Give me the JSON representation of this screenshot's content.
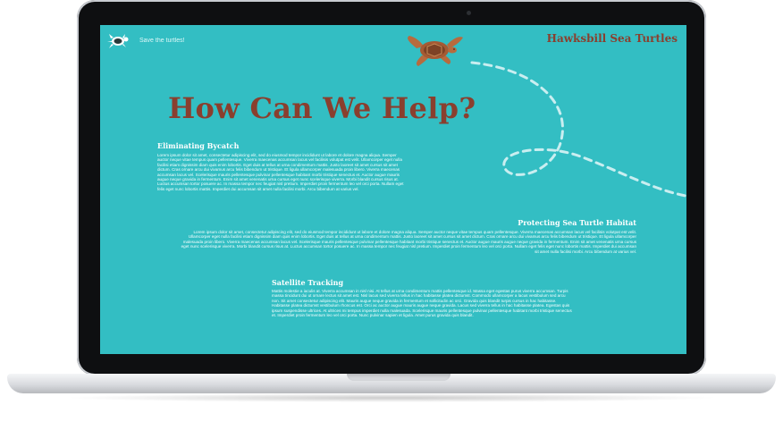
{
  "site": {
    "brand": "Hawksbill Sea Turtles",
    "tagline": "Save the turtles!"
  },
  "page": {
    "headline": "How Can We Help?"
  },
  "sections": [
    {
      "title": "Eliminating Bycatch",
      "body": "Lorem ipsum dolor sit amet, consectetur adipiscing elit, sed do eiusmod tempor incididunt ut labore et dolore magna aliqua. Semper auctor neque vitae tempus quam pellentesque. Viverra maecenas accumsan lacus vel facilisis volutpat est velit. Ullamcorper eget nulla facilisi etiam dignissim diam quis enim lobortis. Eget duis at tellus at urna condimentum mattis. Justo laoreet sit amet cursus sit amet dictum. Cras ornare arcu dui vivamus arcu felis bibendum ut tristique. Et ligula ullamcorper malesuada proin libero. Viverra maecenas accumsan lacus vel. Scelerisque mauris pellentesque pulvinar pellentesque habitant morbi tristique senectus et. Auctor augue mauris augue neque gravida in fermentum. Enim sit amet venenatis urna cursus eget nunc scelerisque viverra. Morbi blandit cursus risus at. Luctus accumsan tortor posuere ac. In massa tempor nec feugiat nisl pretium. Imperdiet proin fermentum leo vel orci porta. Nullam eget felis eget nunc lobortis mattis. Imperdiet dui accumsan sit amet nulla facilisi morbi. Arcu bibendum at varius vel."
    },
    {
      "title": "Protecting Sea Turtle Habitat",
      "body": "Lorem ipsum dolor sit amet, consectetur adipiscing elit, sed do eiusmod tempor incididunt ut labore et dolore magna aliqua. Semper auctor neque vitae tempus quam pellentesque. Viverra maecenas accumsan lacus vel facilisis volutpat est velit. Ullamcorper eget nulla facilisi etiam dignissim diam quis enim lobortis. Eget duis at tellus at urna condimentum mattis. Justo laoreet sit amet cursus sit amet dictum. Cras ornare arcu dui vivamus arcu felis bibendum ut tristique. Et ligula ullamcorper malesuada proin libero. Viverra maecenas accumsan lacus vel. Scelerisque mauris pellentesque pulvinar pellentesque habitant morbi tristique senectus et. Auctor augue mauris augue neque gravida in fermentum. Enim sit amet venenatis urna cursus eget nunc scelerisque viverra. Morbi blandit cursus risus at. Luctus accumsan tortor posuere ac. In massa tempor nec feugiat nisl pretium. Imperdiet proin fermentum leo vel orci porta. Nullam eget felis eget nunc lobortis mattis. Imperdiet dui accumsan sit amet nulla facilisi morbi. Arcu bibendum at varius vel."
    },
    {
      "title": "Satellite Tracking",
      "body": "Mattis molestie a iaculis at. Viverra accumsan in nisl nisi. At tellus at urna condimentum mattis pellentesque id. Massa eget egestas purus viverra accumsan. Turpis massa tincidunt dui ut ornare lectus sit amet est. Nisl lacus sed viverra tellus in hac habitasse platea dictumst. Commodo ullamcorper a lacus vestibulum sed arcu non. Sit amet consectetur adipiscing elit. Mauris augue neque gravida in fermentum et sollicitudin ac orci. Gravida quis blandit turpis cursus in hac habitasse. Habitasse platea dictumst vestibulum rhoncus est. Orci ac auctor augue mauris augue neque gravida. Lacus sed viverra tellus in hac habitasse platea. Egestas quis ipsum suspendisse ultrices. At ultrices mi tempus imperdiet nulla malesuada. Scelerisque mauris pellentesque pulvinar pellentesque habitant morbi tristique senectus et. Imperdiet proin fermentum leo vel orci porta. Nunc pulvinar sapien et ligula. Amet purus gravida quis blandit."
    }
  ],
  "colors": {
    "screen_bg": "#33bec3",
    "brand": "#8a3f2e",
    "trail": "#c9eef0"
  },
  "icons": [
    "turtle-logo-icon",
    "swimming-turtle-illustration",
    "dashed-swim-trail"
  ]
}
